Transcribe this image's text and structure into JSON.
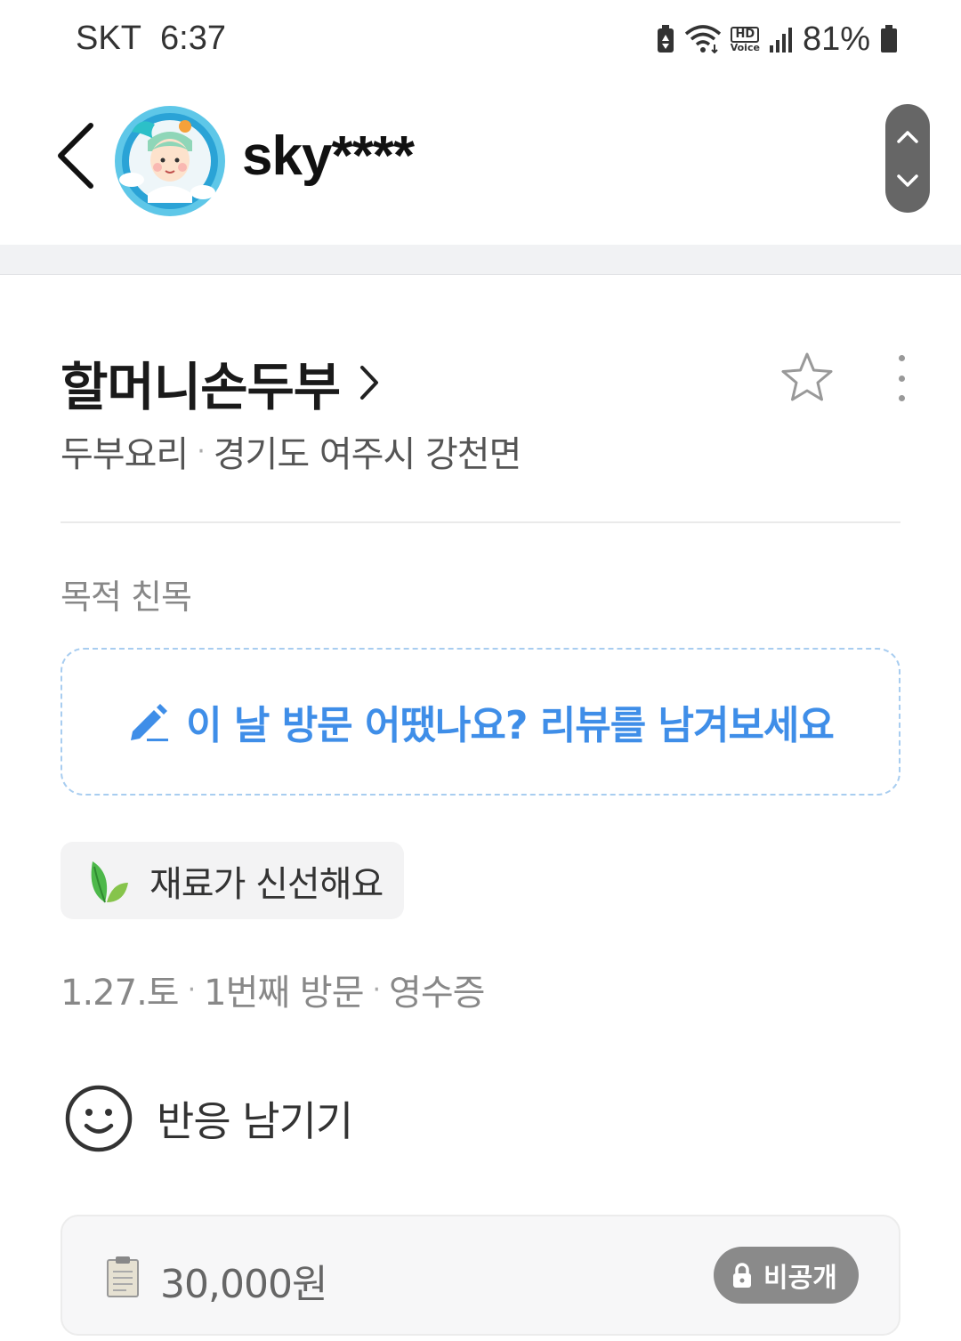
{
  "status_bar": {
    "carrier": "SKT",
    "time": "6:37",
    "hd_label": "HD",
    "voice_label": "Voice",
    "battery_percent": "81%"
  },
  "header": {
    "username": "sky****",
    "avatar_icon": "dragon-grandma-avatar-icon"
  },
  "place": {
    "name": "할머니손두부",
    "category": "두부요리",
    "location": "경기도 여주시 강천면"
  },
  "purpose_label": "목적 친목",
  "review_cta": "이 날 방문 어땠나요? 리뷰를 남겨보세요",
  "keyword_chip": "재료가 신선해요",
  "visit": {
    "date": "1.27.토",
    "count": "1번째 방문",
    "proof": "영수증"
  },
  "reaction_label": "반응 남기기",
  "receipt": {
    "amount": "30,000원",
    "privacy": "비공개"
  },
  "colors": {
    "accent_blue": "#3f8ee8",
    "chip_bg": "#f3f3f4",
    "badge_bg": "#8a8a8a"
  }
}
